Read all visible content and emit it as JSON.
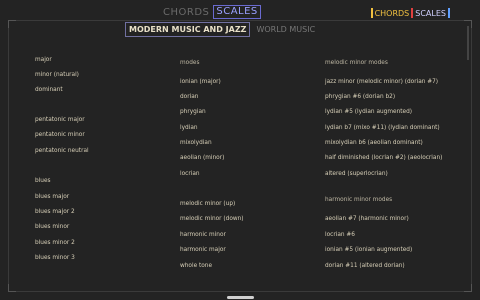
{
  "tabs": {
    "chords": "CHORDS",
    "scales": "SCALES"
  },
  "subtabs": {
    "modern": "MODERN MUSIC AND JAZZ",
    "world": "WORLD MUSIC"
  },
  "logo": {
    "left": "CHORDS",
    "right": "SCALES",
    "color1": "#f0c040",
    "color2": "#e04040",
    "color3": "#60a0ff"
  },
  "col1": [
    {
      "label": "major",
      "y": 0
    },
    {
      "label": "minor (natural)",
      "y": 1
    },
    {
      "label": "dominant",
      "y": 2
    },
    {
      "label": "pentatonic major",
      "y": 3
    },
    {
      "label": "pentatonic minor",
      "y": 4
    },
    {
      "label": "pentatonic neutral",
      "y": 5
    },
    {
      "label": "blues",
      "y": 6
    },
    {
      "label": "blues major",
      "y": 7
    },
    {
      "label": "blues major 2",
      "y": 8
    },
    {
      "label": "blues minor",
      "y": 9
    },
    {
      "label": "blues minor 2",
      "y": 10
    },
    {
      "label": "blues minor 3",
      "y": 11
    }
  ],
  "col2": {
    "header": "modes",
    "items": [
      "ionian (major)",
      "dorian",
      "phrygian",
      "lydian",
      "mixolydian",
      "aeolian (minor)",
      "locrian",
      "melodic minor (up)",
      "melodic minor (down)",
      "harmonic minor",
      "harmonic major",
      "whole tone"
    ]
  },
  "col3": {
    "header1": "melodic minor modes",
    "items1": [
      "jazz minor (melodic minor) (dorian #7)",
      "phrygian #6 (dorian b2)",
      "lydian #5 (lydian augmented)",
      "lydian b7 (mixo #11) (lydian dominant)",
      "mixolydian b6 (aeolian dominant)",
      "half diminished (locrian #2) (aeolocrian)",
      "altered (superlocrian)"
    ],
    "header2": "harmonic minor modes",
    "items2": [
      "aeolian #7 (harmonic minor)",
      "locrian #6",
      "ionian #5 (ionian augmented)",
      "dorian #11 (altered dorian)"
    ]
  }
}
